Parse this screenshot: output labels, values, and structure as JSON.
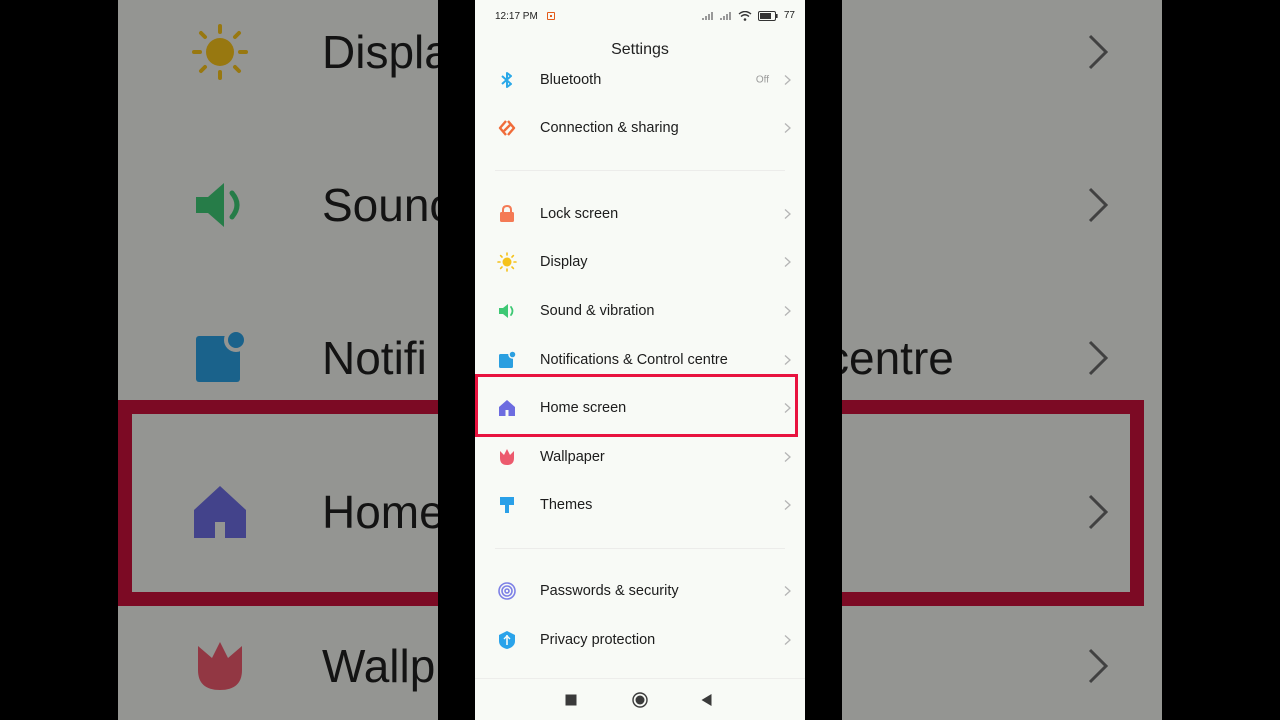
{
  "status_bar": {
    "time": "12:17 PM",
    "battery": "77"
  },
  "title": "Settings",
  "items": [
    {
      "label": "Bluetooth",
      "value": "Off",
      "icon": "bluetooth-icon"
    },
    {
      "label": "Connection & sharing",
      "icon": "connection-sharing-icon"
    },
    {
      "label": "Lock screen",
      "icon": "lock-icon"
    },
    {
      "label": "Display",
      "icon": "sun-icon"
    },
    {
      "label": "Sound & vibration",
      "icon": "speaker-icon"
    },
    {
      "label": "Notifications & Control centre",
      "icon": "notification-icon"
    },
    {
      "label": "Home screen",
      "icon": "home-icon",
      "highlighted": true
    },
    {
      "label": "Wallpaper",
      "icon": "tulip-icon"
    },
    {
      "label": "Themes",
      "icon": "paintbrush-icon"
    },
    {
      "label": "Passwords & security",
      "icon": "fingerprint-icon"
    },
    {
      "label": "Privacy protection",
      "icon": "privacy-shield-icon"
    }
  ],
  "background": {
    "labels": [
      "Displa",
      "Sounc",
      "Notifi",
      "centre",
      "Home",
      "Wallp"
    ]
  },
  "colors": {
    "highlight": "#e8123f",
    "bluetooth": "#2aa8e8",
    "connection": "#f06c3a",
    "lock": "#f47a55",
    "display": "#f5c21b",
    "sound": "#3ec874",
    "notifications": "#2b9fe0",
    "home": "#6d6ce0",
    "wallpaper": "#ec5a6d",
    "themes": "#2aa0e8",
    "security": "#7d80e6",
    "privacy": "#2aa3ea"
  }
}
